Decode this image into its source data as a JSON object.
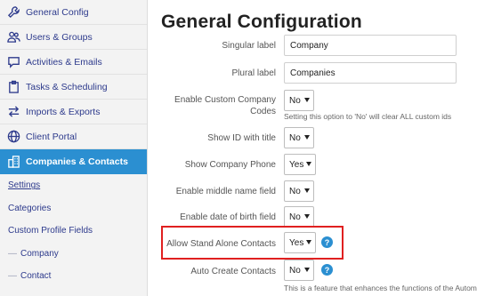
{
  "sidebar": {
    "items": [
      {
        "label": "General Config",
        "icon": "wrench-icon"
      },
      {
        "label": "Users & Groups",
        "icon": "users-icon"
      },
      {
        "label": "Activities & Emails",
        "icon": "chat-icon"
      },
      {
        "label": "Tasks & Scheduling",
        "icon": "clipboard-icon"
      },
      {
        "label": "Imports & Exports",
        "icon": "arrows-icon"
      },
      {
        "label": "Client Portal",
        "icon": "globe-icon"
      },
      {
        "label": "Companies & Contacts",
        "icon": "building-icon"
      }
    ],
    "subitems": [
      {
        "label": "Settings"
      },
      {
        "label": "Categories"
      },
      {
        "label": "Custom Profile Fields"
      },
      {
        "label": "Company",
        "prefix": "—"
      },
      {
        "label": "Contact",
        "prefix": "—"
      }
    ]
  },
  "main": {
    "title": "General Configuration",
    "fields": {
      "singular": {
        "label": "Singular label",
        "value": "Company"
      },
      "plural": {
        "label": "Plural label",
        "value": "Companies"
      },
      "custom_codes": {
        "label": "Enable Custom Company Codes",
        "value": "No",
        "hint": "Setting this option to 'No' will clear ALL custom ids"
      },
      "show_id": {
        "label": "Show ID with title",
        "value": "No"
      },
      "show_phone": {
        "label": "Show Company Phone",
        "value": "Yes"
      },
      "middle_name": {
        "label": "Enable middle name field",
        "value": "No"
      },
      "dob": {
        "label": "Enable date of birth field",
        "value": "No"
      },
      "standalone": {
        "label": "Allow Stand Alone Contacts",
        "value": "Yes",
        "help": "?"
      },
      "auto_create": {
        "label": "Auto Create Contacts",
        "value": "No",
        "help": "?",
        "hint": "This is a feature that enhances the functions of the Automatic"
      }
    }
  },
  "colors": {
    "accent": "#2b8fd1",
    "nav_text": "#2d3a8c",
    "highlight": "#e02020"
  }
}
